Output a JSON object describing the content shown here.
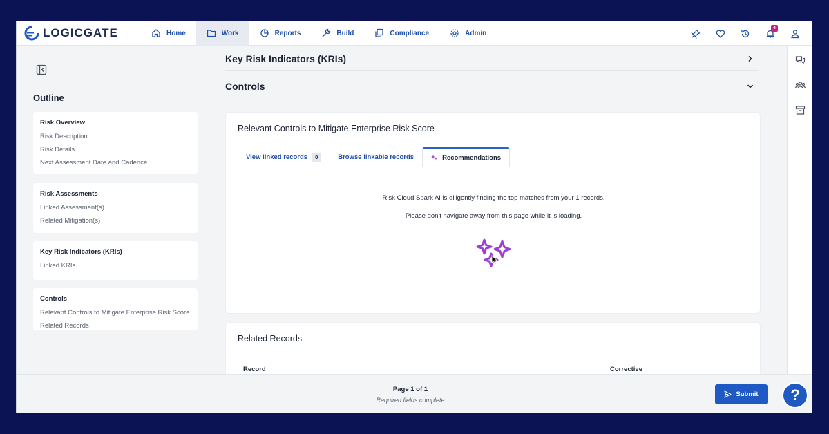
{
  "app": {
    "logo_text": "LOGICGATE"
  },
  "nav": {
    "items": [
      {
        "label": "Home",
        "icon": "home-icon"
      },
      {
        "label": "Work",
        "icon": "folder-icon",
        "active": true
      },
      {
        "label": "Reports",
        "icon": "chart-icon"
      },
      {
        "label": "Build",
        "icon": "wrench-icon"
      },
      {
        "label": "Compliance",
        "icon": "copy-icon"
      },
      {
        "label": "Admin",
        "icon": "gear-icon"
      }
    ],
    "notification_count": "4"
  },
  "outline": {
    "title": "Outline",
    "groups": [
      {
        "heading": "Risk Overview",
        "items": [
          "Risk Description",
          "Risk Details",
          "Next Assessment Date and Cadence"
        ]
      },
      {
        "heading": "Risk Assessments",
        "items": [
          "Linked Assessment(s)",
          "Related Mitigation(s)"
        ]
      },
      {
        "heading": "Key Risk Indicators (KRIs)",
        "items": [
          "Linked KRIs"
        ]
      },
      {
        "heading": "Controls",
        "items": [
          "Relevant Controls to Mitigate Enterprise Risk Score",
          "Related Records"
        ]
      }
    ]
  },
  "main": {
    "kri_section": "Key Risk Indicators (KRIs)",
    "controls_section": "Controls",
    "controls_card": {
      "title": "Relevant Controls to Mitigate Enterprise Risk Score",
      "tabs": {
        "linked": "View linked records",
        "linked_count": "0",
        "browse": "Browse linkable records",
        "recommendations": "Recommendations"
      },
      "loading_line1": "Risk Cloud Spark AI is diligently finding the top matches from your 1 records.",
      "loading_line2": "Please don't navigate away from this page while it is loading."
    },
    "related_card": {
      "title": "Related Records",
      "col_record": "Record",
      "col_corrective": "Corrective"
    }
  },
  "footer": {
    "page": "Page 1 of 1",
    "status": "Required fields complete",
    "submit": "Submit",
    "help": "?"
  },
  "colors": {
    "accent": "#1f5ac4",
    "sparkle": "#9b3fd6",
    "badge": "#d01c7a",
    "backdrop": "#0b1354"
  }
}
